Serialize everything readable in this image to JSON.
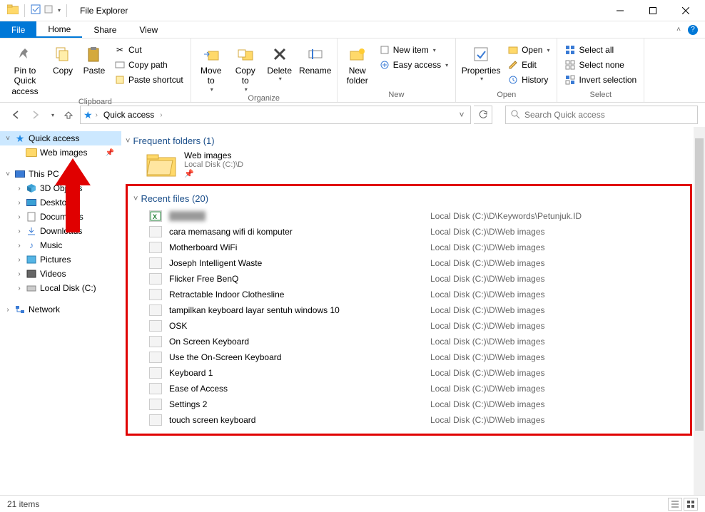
{
  "title": "File Explorer",
  "ribbon_tabs": {
    "file": "File",
    "home": "Home",
    "share": "Share",
    "view": "View"
  },
  "ribbon": {
    "clipboard": {
      "label": "Clipboard",
      "pin": "Pin to Quick access",
      "copy": "Copy",
      "paste": "Paste",
      "cut": "Cut",
      "copy_path": "Copy path",
      "paste_shortcut": "Paste shortcut"
    },
    "organize": {
      "label": "Organize",
      "move_to": "Move to",
      "copy_to": "Copy to",
      "delete": "Delete",
      "rename": "Rename"
    },
    "new": {
      "label": "New",
      "new_folder": "New folder",
      "new_item": "New item",
      "easy_access": "Easy access"
    },
    "open": {
      "label": "Open",
      "properties": "Properties",
      "open": "Open",
      "edit": "Edit",
      "history": "History"
    },
    "select": {
      "label": "Select",
      "select_all": "Select all",
      "select_none": "Select none",
      "invert": "Invert selection"
    }
  },
  "breadcrumb": {
    "root": "Quick access"
  },
  "search": {
    "placeholder": "Search Quick access"
  },
  "nav": {
    "quick_access": "Quick access",
    "web_images": "Web images",
    "this_pc": "This PC",
    "threed": "3D Objects",
    "desktop": "Desktop",
    "documents": "Documents",
    "downloads": "Downloads",
    "music": "Music",
    "pictures": "Pictures",
    "videos": "Videos",
    "local_disk": "Local Disk (C:)",
    "network": "Network"
  },
  "sections": {
    "frequent": "Frequent folders (1)",
    "recent": "Recent files (20)"
  },
  "frequent": {
    "name": "Web images",
    "path": "Local Disk (C:)\\D"
  },
  "recent_files": [
    {
      "name": "redacted",
      "path": "Local Disk (C:)\\D\\Keywords\\Petunjuk.ID",
      "blurred": true,
      "excel": true
    },
    {
      "name": "cara memasang wifi di komputer",
      "path": "Local Disk (C:)\\D\\Web images"
    },
    {
      "name": "Motherboard WiFi",
      "path": "Local Disk (C:)\\D\\Web images"
    },
    {
      "name": "Joseph Intelligent Waste",
      "path": "Local Disk (C:)\\D\\Web images"
    },
    {
      "name": "Flicker Free BenQ",
      "path": "Local Disk (C:)\\D\\Web images"
    },
    {
      "name": "Retractable Indoor Clothesline",
      "path": "Local Disk (C:)\\D\\Web images"
    },
    {
      "name": "tampilkan keyboard layar sentuh windows 10",
      "path": "Local Disk (C:)\\D\\Web images"
    },
    {
      "name": "OSK",
      "path": "Local Disk (C:)\\D\\Web images"
    },
    {
      "name": "On Screen Keyboard",
      "path": "Local Disk (C:)\\D\\Web images"
    },
    {
      "name": "Use the On-Screen Keyboard",
      "path": "Local Disk (C:)\\D\\Web images"
    },
    {
      "name": "Keyboard 1",
      "path": "Local Disk (C:)\\D\\Web images"
    },
    {
      "name": "Ease of Access",
      "path": "Local Disk (C:)\\D\\Web images"
    },
    {
      "name": "Settings 2",
      "path": "Local Disk (C:)\\D\\Web images"
    },
    {
      "name": "touch screen keyboard",
      "path": "Local Disk (C:)\\D\\Web images"
    }
  ],
  "status": {
    "item_count": "21 items"
  }
}
